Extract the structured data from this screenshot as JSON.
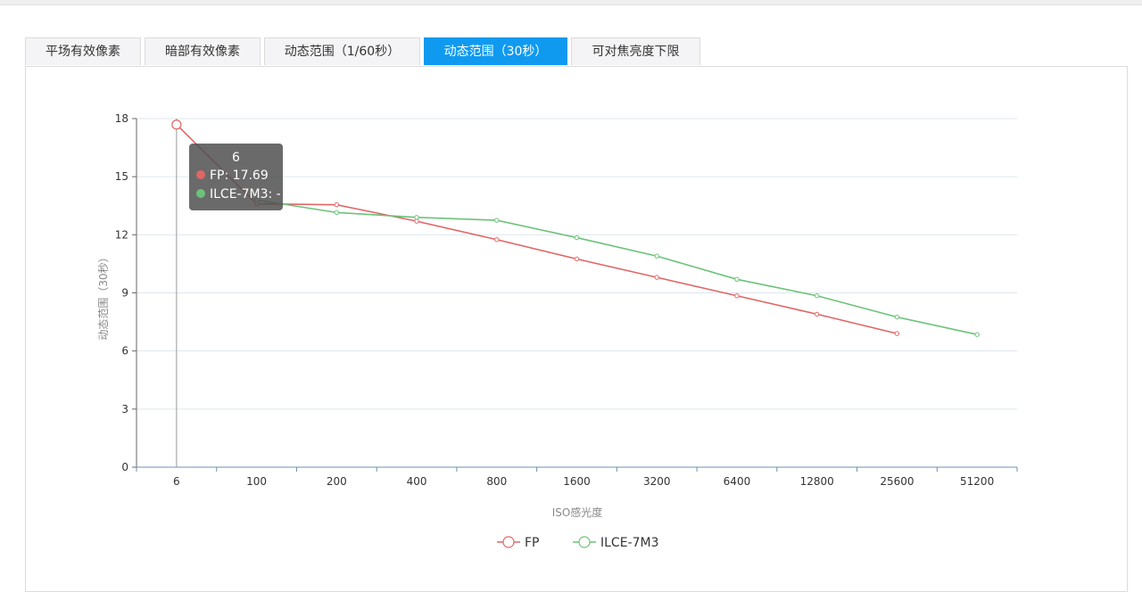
{
  "tabs": [
    {
      "label": "平场有效像素",
      "active": false
    },
    {
      "label": "暗部有效像素",
      "active": false
    },
    {
      "label": "动态范围（1/60秒）",
      "active": false
    },
    {
      "label": "动态范围（30秒）",
      "active": true
    },
    {
      "label": "可对焦亮度下限",
      "active": false
    }
  ],
  "colors": {
    "accent": "#0f9af0",
    "fp": "#e06666",
    "ilce": "#6cc27a",
    "grid": "#dfe6ee",
    "tooltip_bg": "#505050"
  },
  "chart_data": {
    "type": "line",
    "categories": [
      "6",
      "100",
      "200",
      "400",
      "800",
      "1600",
      "3200",
      "6400",
      "12800",
      "25600",
      "51200"
    ],
    "series": [
      {
        "name": "FP",
        "values": [
          17.69,
          13.6,
          13.55,
          12.7,
          11.75,
          10.75,
          9.8,
          8.85,
          7.9,
          6.9,
          null
        ]
      },
      {
        "name": "ILCE-7M3",
        "values": [
          null,
          13.8,
          13.15,
          12.9,
          12.75,
          11.85,
          10.9,
          9.7,
          8.85,
          7.75,
          6.85
        ]
      }
    ],
    "xlabel": "ISO感光度",
    "ylabel": "动态范围（30秒）",
    "ylim": [
      0,
      18
    ],
    "yticks": [
      0,
      3,
      6,
      9,
      12,
      15,
      18
    ],
    "grid": true,
    "legend": "bottom-center"
  },
  "tooltip": {
    "title": "6",
    "rows": [
      {
        "series": "FP",
        "text": "FP: 17.69"
      },
      {
        "series": "ILCE-7M3",
        "text": "ILCE-7M3: -"
      }
    ]
  }
}
